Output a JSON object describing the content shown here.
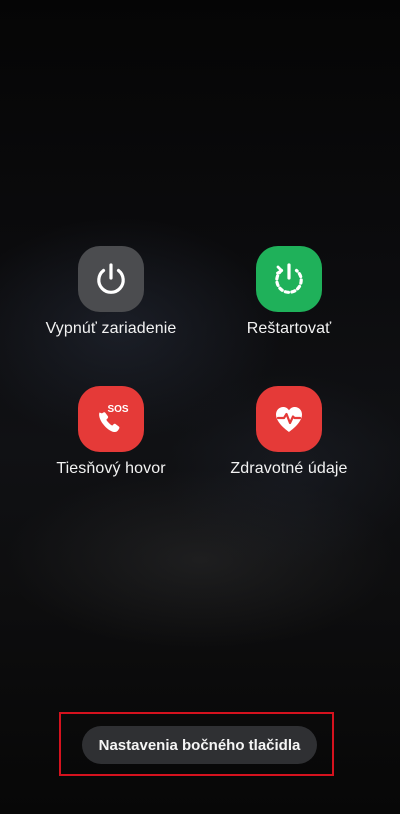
{
  "power_menu": {
    "items": [
      {
        "id": "power_off",
        "label": "Vypnúť zariadenie",
        "icon": "power-icon",
        "color": "#4b4c4f"
      },
      {
        "id": "restart",
        "label": "Reštartovať",
        "icon": "restart-icon",
        "color": "#1fb15a"
      },
      {
        "id": "emergency_call",
        "label": "Tiesňový hovor",
        "icon": "sos-phone-icon",
        "icon_text": "SOS",
        "color": "#e53a38"
      },
      {
        "id": "medical_info",
        "label": "Zdravotné údaje",
        "icon": "heart-pulse-icon",
        "color": "#e53a38"
      }
    ]
  },
  "side_key_settings": {
    "label": "Nastavenia bočného tlačidla",
    "highlight_color": "#d5121e"
  }
}
